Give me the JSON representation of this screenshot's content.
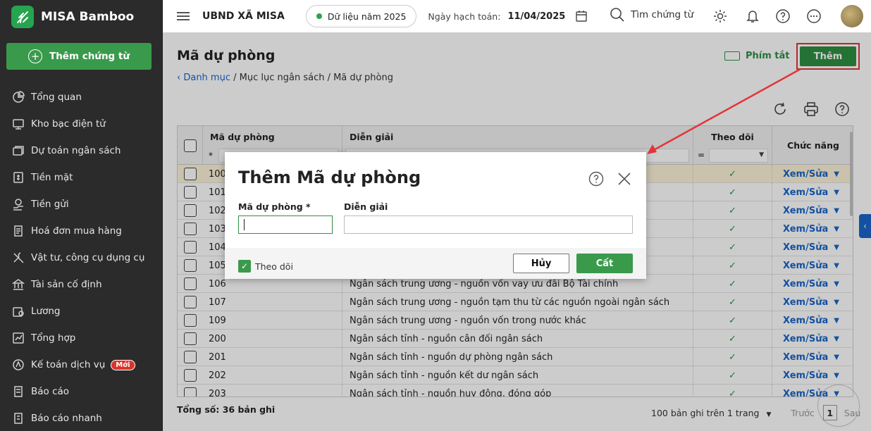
{
  "app": {
    "name": "MISA Bamboo",
    "add_voucher_label": "Thêm chứng từ"
  },
  "sidebar": {
    "items": [
      {
        "label": "Tổng quan",
        "icon": "pie-chart-icon"
      },
      {
        "label": "Kho bạc điện tử",
        "icon": "monitor-icon"
      },
      {
        "label": "Dự toán ngân sách",
        "icon": "budget-icon"
      },
      {
        "label": "Tiền mặt",
        "icon": "cash-icon"
      },
      {
        "label": "Tiền gửi",
        "icon": "deposit-icon"
      },
      {
        "label": "Hoá đơn mua hàng",
        "icon": "invoice-icon"
      },
      {
        "label": "Vật tư, công cụ dụng cụ",
        "icon": "tools-icon"
      },
      {
        "label": "Tài sản cố định",
        "icon": "bank-icon"
      },
      {
        "label": "Lương",
        "icon": "salary-icon"
      },
      {
        "label": "Tổng hợp",
        "icon": "summary-icon"
      },
      {
        "label": "Kế toán dịch vụ",
        "icon": "service-icon",
        "badge": "Mới"
      },
      {
        "label": "Báo cáo",
        "icon": "report-icon"
      },
      {
        "label": "Báo cáo nhanh",
        "icon": "quick-report-icon"
      }
    ]
  },
  "header": {
    "org": "UBND XÃ MISA",
    "data_year": "Dữ liệu năm 2025",
    "posting_label": "Ngày hạch toán:",
    "posting_date": "11/04/2025",
    "search_label": "Tìm chứng từ"
  },
  "page": {
    "title": "Mã dự phòng",
    "breadcrumb_link": "Danh mục",
    "breadcrumb_rest": " / Mục lục ngân sách / Mã dự phòng",
    "shortcut_label": "Phím tắt",
    "add_label": "Thêm"
  },
  "table": {
    "columns": {
      "code": "Mã dự phòng",
      "desc": "Diễn giải",
      "follow": "Theo dõi",
      "action": "Chức năng"
    },
    "filter_code_op": "*",
    "filter_follow_op": "=",
    "action_label": "Xem/Sửa",
    "rows": [
      {
        "code": "100",
        "desc": "",
        "follow": "✓",
        "selected": true
      },
      {
        "code": "101",
        "desc": "",
        "follow": "✓"
      },
      {
        "code": "102",
        "desc": "",
        "follow": "✓"
      },
      {
        "code": "103",
        "desc": "",
        "follow": "✓"
      },
      {
        "code": "104",
        "desc": "",
        "follow": "✓"
      },
      {
        "code": "105",
        "desc": "",
        "follow": "✓"
      },
      {
        "code": "106",
        "desc": "Ngân sách trung ương - nguồn vốn vay ưu đãi Bộ Tài chính",
        "follow": "✓"
      },
      {
        "code": "107",
        "desc": "Ngân sách trung ương - nguồn tạm thu từ các nguồn ngoài ngân sách",
        "follow": "✓"
      },
      {
        "code": "109",
        "desc": "Ngân sách trung ương - nguồn vốn trong nước khác",
        "follow": "✓"
      },
      {
        "code": "200",
        "desc": "Ngân sách tỉnh - nguồn cân đối ngân sách",
        "follow": "✓"
      },
      {
        "code": "201",
        "desc": "Ngân sách tỉnh - nguồn dự phòng ngân sách",
        "follow": "✓"
      },
      {
        "code": "202",
        "desc": "Ngân sách tỉnh - nguồn kết dư ngân sách",
        "follow": "✓"
      },
      {
        "code": "203",
        "desc": "Ngân sách tỉnh - nguồn huy động, đóng góp",
        "follow": "✓"
      }
    ]
  },
  "footer": {
    "total": "Tổng số: 36 bản ghi",
    "page_size": "100 bản ghi trên 1 trang",
    "prev": "Trước",
    "page": "1",
    "next": "Sau"
  },
  "dialog": {
    "title": "Thêm Mã dự phòng",
    "code_label": "Mã dự phòng *",
    "desc_label": "Diễn giải",
    "code_value": "",
    "desc_value": "",
    "follow_label": "Theo dõi",
    "cancel_label": "Hủy",
    "save_label": "Cất"
  },
  "colors": {
    "brand_green": "#2f8f43",
    "link_blue": "#1a66c8",
    "highlight_red": "#e3353a",
    "sidebar_bg": "#2b2b2b"
  }
}
